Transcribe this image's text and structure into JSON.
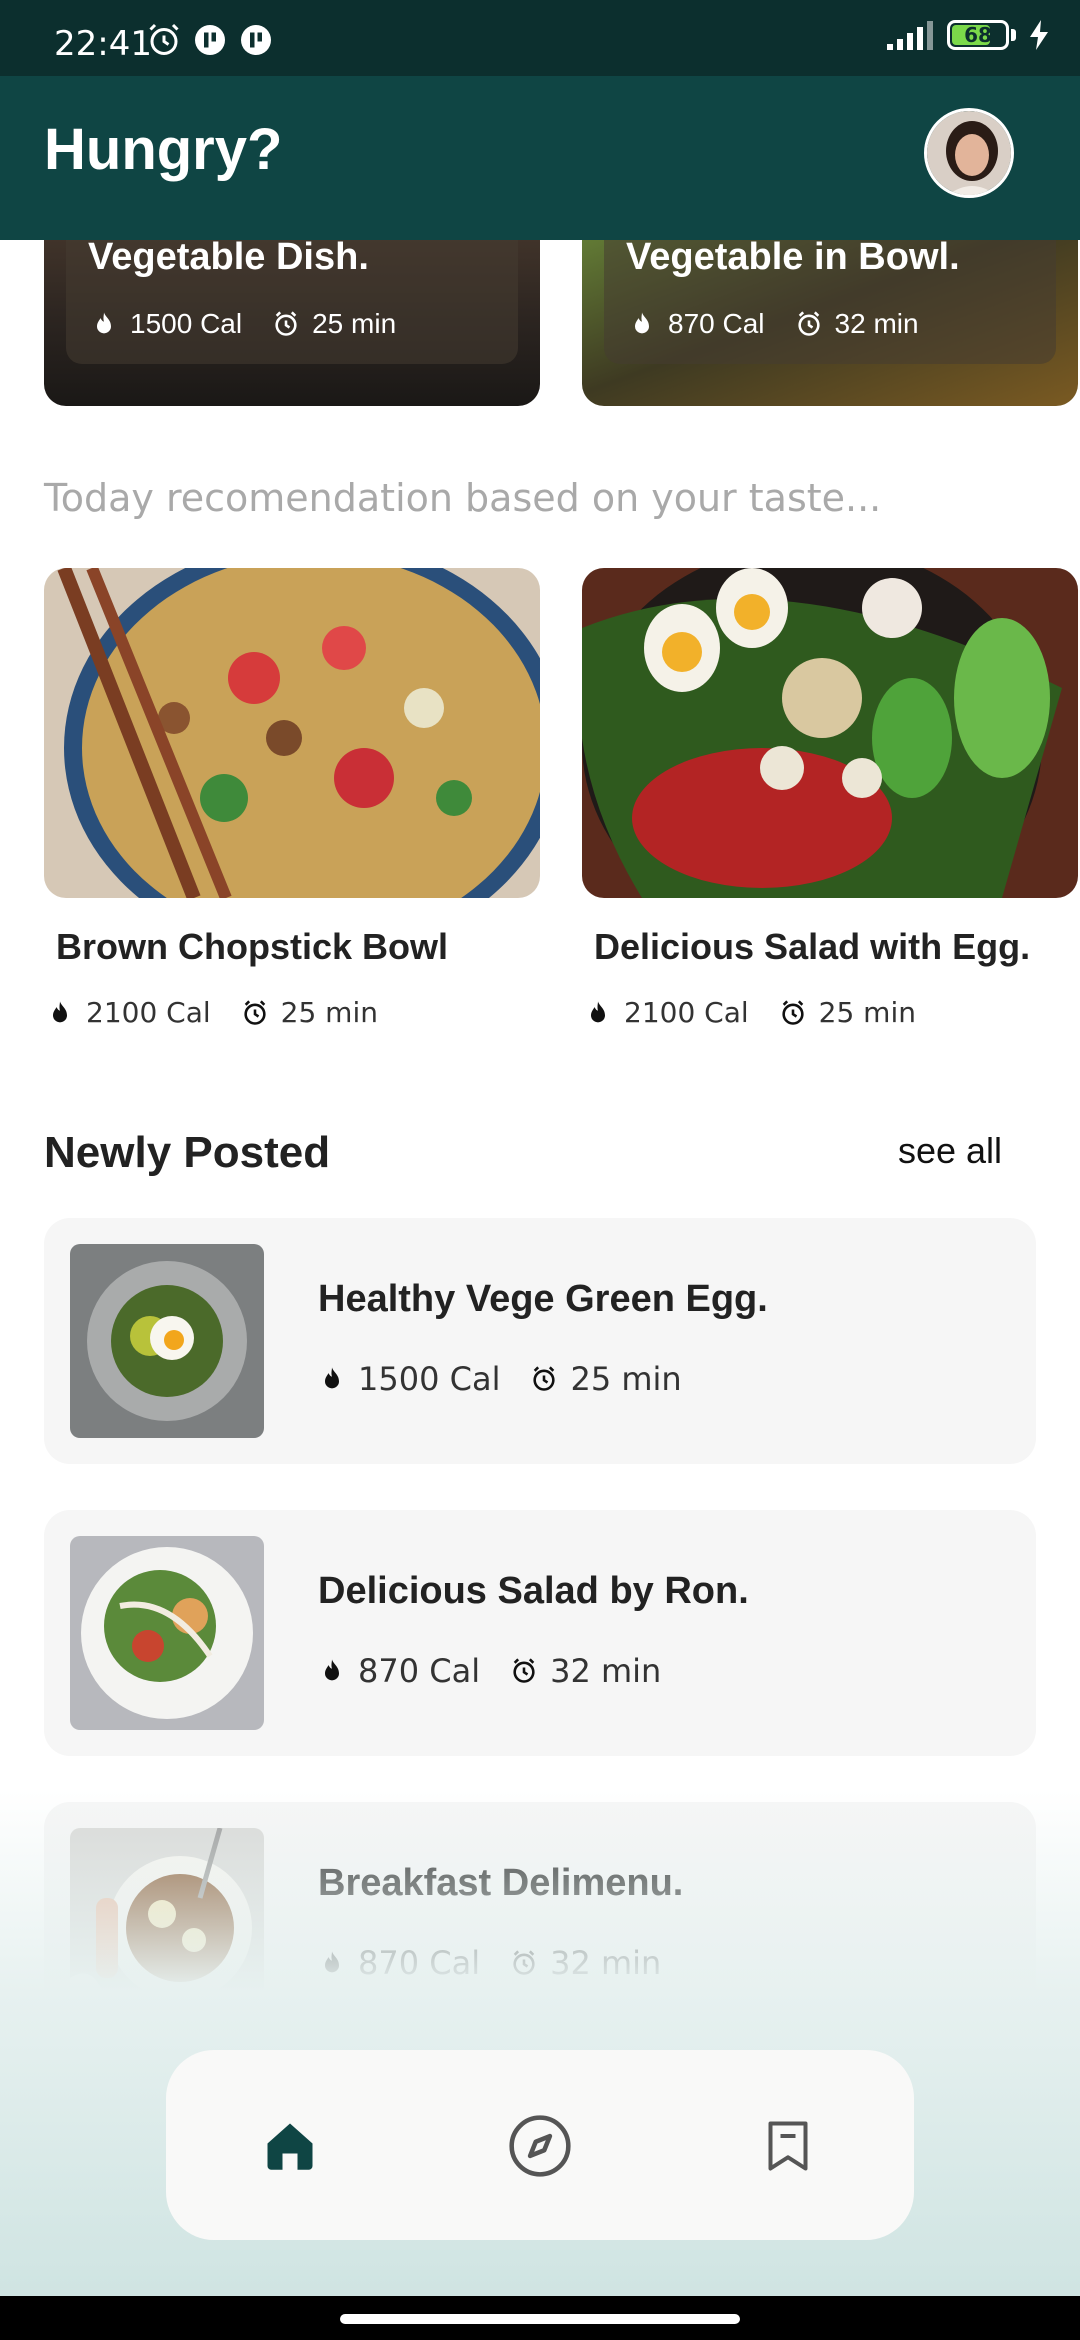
{
  "status_bar": {
    "time": "22:41",
    "battery": "68"
  },
  "header": {
    "title": "Hungry?"
  },
  "featured": [
    {
      "title": "Vegetable Dish.",
      "calories": "1500 Cal",
      "time": "25 min"
    },
    {
      "title": "Vegetable in Bowl.",
      "calories": "870 Cal",
      "time": "32 min"
    }
  ],
  "recommendation_hint": "Today recomendation based on your taste...",
  "recommendations": [
    {
      "title": "Brown Chopstick Bowl",
      "calories": "2100 Cal",
      "time": "25 min"
    },
    {
      "title": "Delicious Salad with Egg.",
      "calories": "2100 Cal",
      "time": "25 min"
    }
  ],
  "newly_posted": {
    "title": "Newly Posted",
    "see_all": "see all",
    "items": [
      {
        "title": "Healthy Vege Green Egg.",
        "calories": "1500 Cal",
        "time": "25 min"
      },
      {
        "title": "Delicious Salad by Ron.",
        "calories": "870 Cal",
        "time": "32 min"
      },
      {
        "title": "Breakfast Delimenu.",
        "calories": "870 Cal",
        "time": "32 min"
      }
    ]
  },
  "nav": {
    "active": "home"
  },
  "colors": {
    "header": "#0f4544",
    "status_bar": "#0c2f2e",
    "accent": "#0f4544",
    "card_bg": "#f6f6f6"
  }
}
